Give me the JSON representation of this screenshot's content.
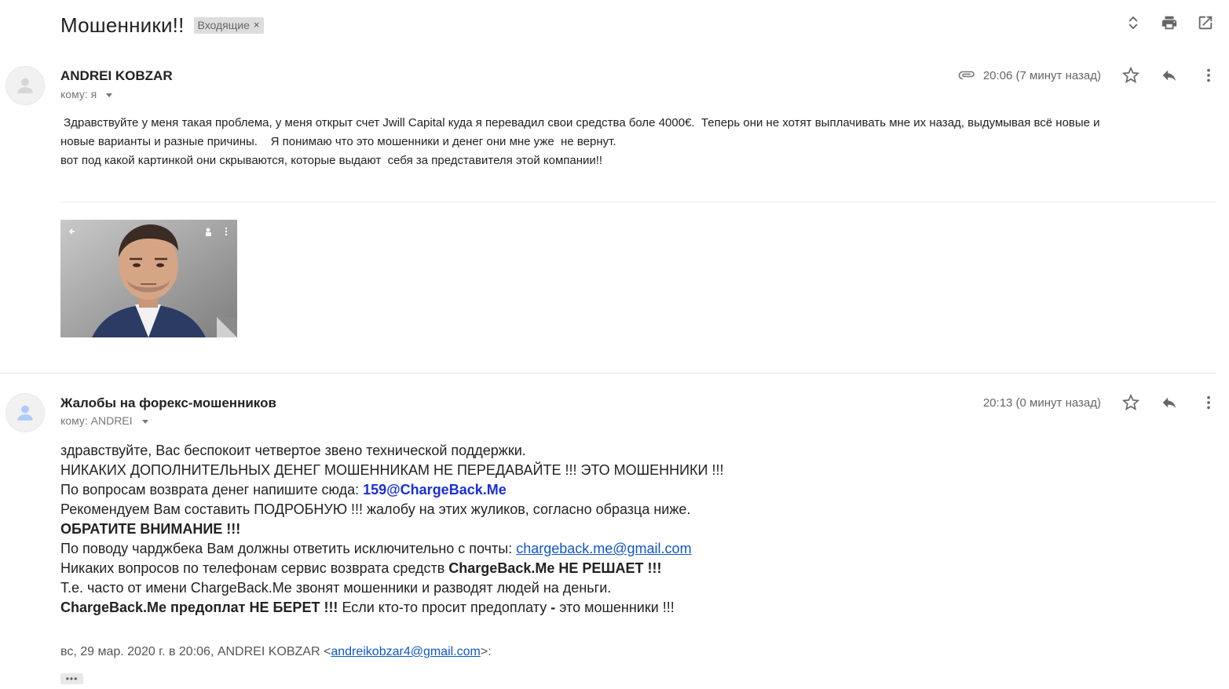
{
  "subject": "Мошенники!!",
  "label": {
    "text": "Входящие",
    "remove": "×"
  },
  "msg1": {
    "sender": "ANDREI KOBZAR",
    "to": "кому: я",
    "time": "20:06 (7 минут назад)",
    "body": [
      " Здравствуйте у меня такая проблема, у меня открыт счет Jwill Capital куда я перевадил свои средства боле 4000€.  Теперь они не хотят выплачивать мне их назад, выдумывая всё новые и",
      "новые варианты и разные причины.    Я понимаю что это мошенники и денег они мне уже  не вернут.",
      "вот под какой картинкой они скрываются, которые выдают  себя за представителя этой компании!!"
    ]
  },
  "msg2": {
    "sender": "Жалобы на форекс-мошенников",
    "to": "кому: ANDREI",
    "time": "20:13 (0 минут назад)",
    "l1": "здравствуйте, Вас беспокоит четвертое звено технической поддержки.",
    "l2": "НИКАКИХ ДОПОЛНИТЕЛЬНЫХ ДЕНЕГ МОШЕННИКАМ НЕ ПЕРЕДАВАЙТЕ !!! ЭТО МОШЕННИКИ !!!",
    "l3a": "По вопросам возврата денег напишите сюда: ",
    "l3b": "159@ChargeBack.Me",
    "l4": "Рекомендуем Вам составить ПОДРОБНУЮ !!! жалобу на этих жуликов, согласно образца ниже.",
    "l5": "ОБРАТИТЕ ВНИМАНИЕ !!!",
    "l6a": "По поводу чарджбека Вам должны ответить исключительно с почты: ",
    "l6b": "chargeback.me@gmail.com",
    "l7a": "Никаких вопросов по телефонам сервис возврата средств ",
    "l7b": "ChargeBack.Me НЕ РЕШАЕТ !!!",
    "l8": "Т.е. часто от имени ChargeBack.Me звонят мошенники и разводят людей на деньги.",
    "l9a": "ChargeBack.Me предоплат НЕ БЕРЕТ !!!",
    "l9b": " Если кто-то просит предоплату ",
    "l9c": "-",
    "l9d": " это мошенники !!!",
    "quote_a": "вс, 29 мар. 2020 г. в 20:06, ANDREI KOBZAR <",
    "quote_email": "andreikobzar4@gmail.com",
    "quote_b": ">:",
    "ellipsis": "•••"
  }
}
